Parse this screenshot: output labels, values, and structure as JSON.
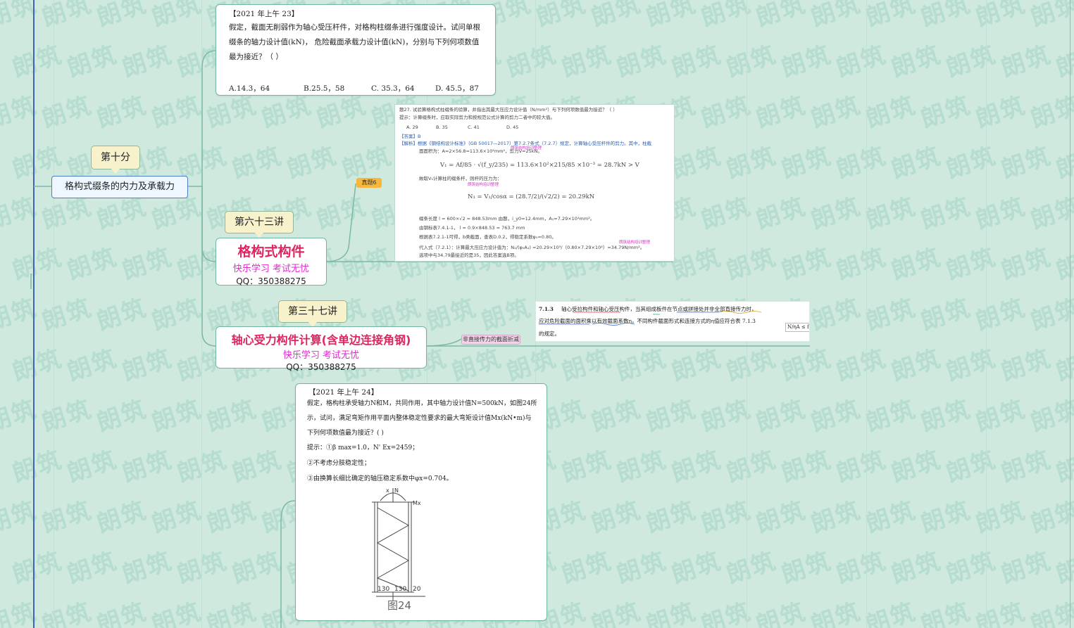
{
  "watermark_text": "朗筑",
  "topic": {
    "label": "格构式缀条的内力及承载力"
  },
  "callouts": {
    "tenth": "第十分",
    "lect63": "第六十三讲",
    "lect37": "第三十七讲"
  },
  "lecture63": {
    "title": "格构式构件",
    "slogan": "快乐学习  考试无忧",
    "qq": "QQ：350388275"
  },
  "lecture37": {
    "title": "轴心受力构件计算(含单边连接角钢)",
    "slogan": "快乐学习  考试无忧",
    "qq": "QQ：350388275"
  },
  "question23": {
    "header": "【2021  年上午  23】",
    "line1": "假定，截面无削弱作为轴心受压杆件，对格构柱缀条进行强度设计。试问单根",
    "line2": "缀条的轴力设计值(kN)，  危险截面承载力设计值(kN)，分别与下列何项数值",
    "line3": "最为接近？（        ）",
    "options": [
      "A.14.3，64",
      "B.25.5，58",
      "C. 35.3，64",
      "D. 45.5，87"
    ]
  },
  "tags": {
    "zhenti": "真题6",
    "net_area": "非直接传力的截面折减"
  },
  "scan27": {
    "q": "题27. 试验算格构式柱缀条的验算，并指出其最大压应力设计值（N/mm²）与下列何项数值最为接近？（     ）",
    "hint": "提示：计算缀条时，应取实际剪力和按规范公式计算的剪力二者中的较大值。",
    "opts": [
      "A. 29",
      "B. 35",
      "C. 41",
      "D. 45"
    ],
    "ans": "【答案】B",
    "jx": "【解析】根据《钢结构设计标准》（GB 50017—2017）第7.2.7条式（7.2.7）规定，计算轴心受压杆件的剪力。其中，柱截",
    "area": "面面积为：A=2×56.8=113.6×10²mm²，剪力V=25kN。",
    "eq1": "V₁ = Af/85 · √(f_y/235) = 113.6×10²×215/85 ×10⁻³ = 28.7kN > V",
    "note1": "故取V₁计算柱的缀条杆，则杆的压力为：",
    "eq2": "N₁ = V₁/cosα = (28.7/2)/(√2/2) = 20.29kN",
    "len": "缀条长度 l = 600×√2 = 848.53mm  由题，i_y0=12.4mm，A₁=7.29×10²mm²。",
    "tbl": "由钢标表7.4.1-1， l = 0.9×848.53 = 763.7 mm",
    "phi": "根据表7.2.1-1可得，b类截面，查表D.0.2，得稳定系数φ₀=0.80。",
    "sub": "代入式（7.2.1）：计算最大压应力设计值为：N₁/(φ₀A₁) =20.29×10³/（0.80×7.29×10²）=34.79N/mm²。",
    "fin": "选项中与34.79最接近的是35，因此答案选B项。",
    "stamp": "朗筑结构培训整理"
  },
  "scan713": {
    "num": "7.1.3",
    "line1": "轴心受拉构件和轴心受压构件，当其组成板件在节点或拼接处并非全部直接传力时，",
    "line2": "应对危险截面的面积乘以有效截面系数η，不同构件截面形式和连接方式的η值应符合表 7.1.3",
    "line3": "的规定。",
    "formula": "N/ηA ≤ f"
  },
  "question24": {
    "header": "【2021  年上午  24】",
    "line1": "假定，格构柱承受轴力N和M，共同作用，其中轴力设计值N=500kN，如图24所",
    "line2": "示，试问，满足弯矩作用平面内整体稳定性要求的最大弯矩设计值Mx(kN•m)与",
    "line3": "下列何项数值最为接近？(         )",
    "hint1": "提示：①β max=1.0，N' Ex=2459；",
    "hint2": "②不考虑分肢稳定性；",
    "hint3": "③由换算长细比确定的轴压稳定系数中φx=0.704。",
    "fig": {
      "x_label": "x",
      "n_label": "N",
      "m_label": "Mx",
      "dims": [
        "130",
        "130",
        "20"
      ],
      "caption": "图24"
    }
  },
  "colors": {
    "background": "#cfe9df",
    "line": "#7ab9a3",
    "title_red": "#e0245e",
    "slogan_magenta": "#e02ad0",
    "tag_orange": "#f6b73c"
  }
}
